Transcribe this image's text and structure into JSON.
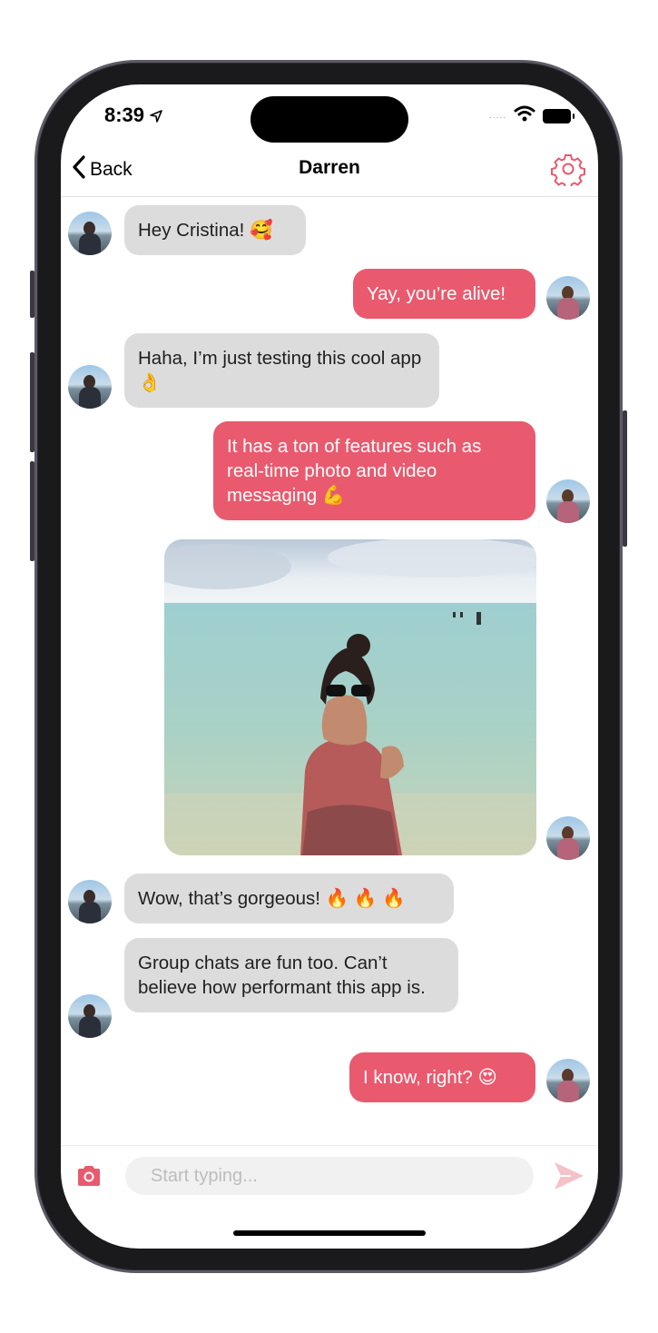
{
  "status_bar": {
    "time": "8:39",
    "signal": "....."
  },
  "nav": {
    "back_label": "Back",
    "title": "Darren"
  },
  "messages": [
    {
      "direction": "in",
      "text": "Hey Cristina! 🥰"
    },
    {
      "direction": "out",
      "text": "Yay, you’re alive!"
    },
    {
      "direction": "in",
      "text": "Haha, I’m just testing this cool app 👌"
    },
    {
      "direction": "out",
      "text": "It has a ton of features such as real-time photo and video messaging 💪"
    },
    {
      "direction": "out",
      "type": "photo"
    },
    {
      "direction": "in",
      "text": "Wow, that’s gorgeous! 🔥 🔥 🔥"
    },
    {
      "direction": "in",
      "text": "Group chats are fun too. Can’t believe how performant this app is."
    },
    {
      "direction": "out",
      "text": "I know, right? 😍"
    }
  ],
  "composer": {
    "placeholder": "Start typing..."
  },
  "colors": {
    "accent": "#e95a6e",
    "incoming_bubble": "#dcdcdc",
    "send_disabled": "#f6c2c9"
  },
  "icons": [
    "navigation-arrow-icon",
    "wifi-icon",
    "battery-icon",
    "chevron-left-icon",
    "gear-icon",
    "camera-icon",
    "send-icon"
  ]
}
